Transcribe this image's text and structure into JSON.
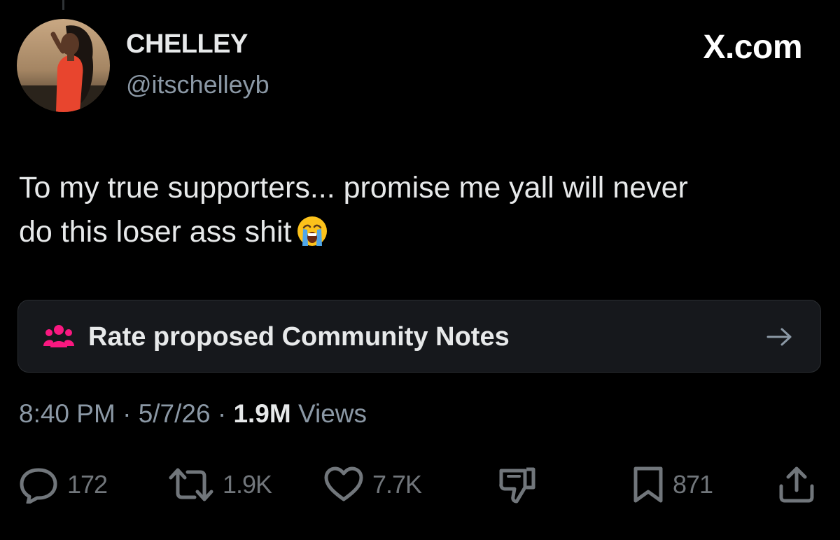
{
  "post": {
    "display_name": "CHELLEY",
    "handle": "@itschelleyb",
    "watermark": "X.com",
    "text_line1": "To my true supporters... promise me yall will never",
    "text_line2": "do this loser ass shit",
    "emoji": "loudly-crying-face"
  },
  "community_notes": {
    "label": "Rate proposed Community Notes",
    "icon": "people-icon",
    "accent_color": "#f91880"
  },
  "meta": {
    "time": "8:40 PM",
    "sep1": "·",
    "date": "5/7/26",
    "sep2": "·",
    "views_count": "1.9M",
    "views_label": "Views"
  },
  "actions": {
    "replies": "172",
    "reposts": "1.9K",
    "likes": "7.7K",
    "bookmarks": "871"
  },
  "colors": {
    "background": "#000000",
    "primary_text": "#e7e9ea",
    "secondary_text": "#8b98a5",
    "card_background": "#16181c"
  }
}
